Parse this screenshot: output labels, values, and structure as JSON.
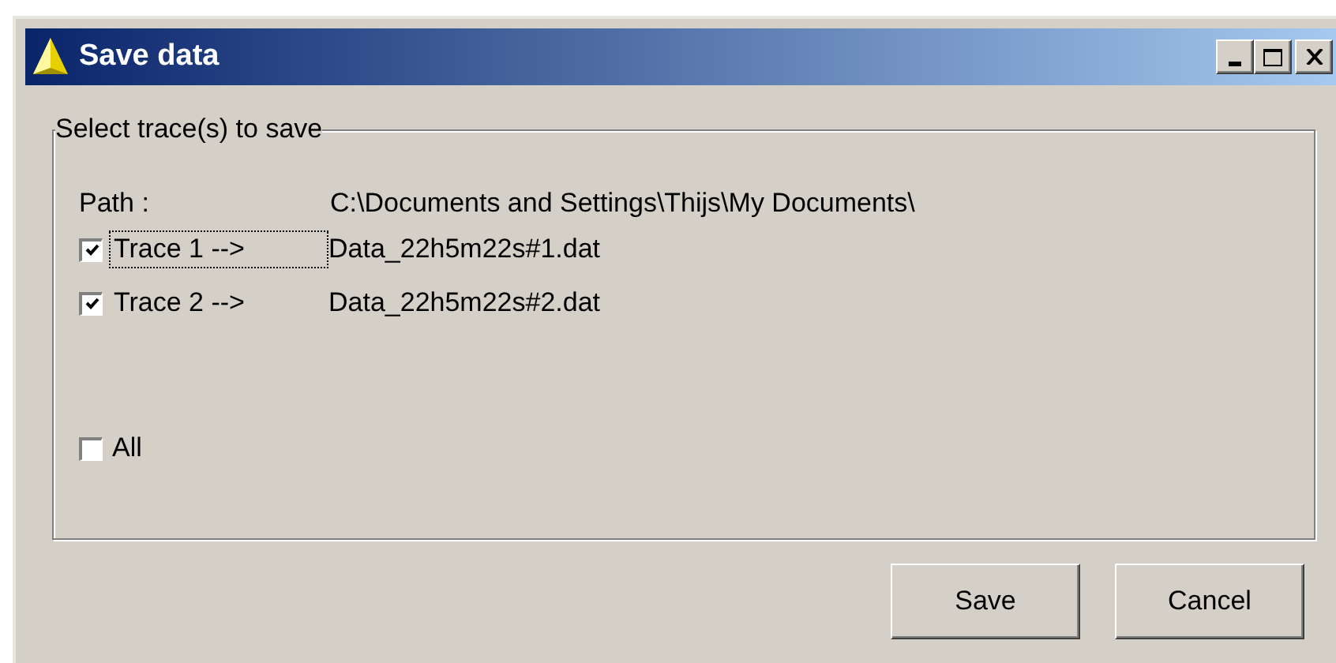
{
  "window": {
    "title": "Save data"
  },
  "group": {
    "label": "Select trace(s) to save",
    "path": {
      "label": "Path :",
      "value": "C:\\Documents and Settings\\Thijs\\My Documents\\"
    },
    "traces": [
      {
        "label": "Trace 1 -->",
        "file": "Data_22h5m22s#1.dat",
        "checked": true,
        "focused": true
      },
      {
        "label": "Trace 2 -->",
        "file": "Data_22h5m22s#2.dat",
        "checked": true,
        "focused": false
      }
    ],
    "all": {
      "label": "All",
      "checked": false
    }
  },
  "buttons": [
    "Save",
    "Cancel"
  ]
}
